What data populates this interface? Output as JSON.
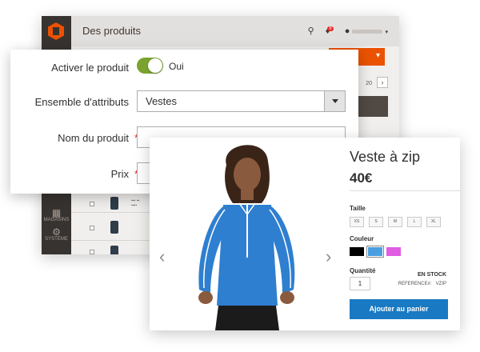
{
  "admin": {
    "title": "Des produits",
    "notification_count": "8",
    "pager_value": "20",
    "nav": [
      {
        "label": "MAGASINS",
        "icon": "store-icon"
      },
      {
        "label": "SYSTÈME",
        "icon": "gear-icon"
      }
    ]
  },
  "form": {
    "enable": {
      "label": "Activer le produit",
      "toggle_text": "Oui",
      "value": true
    },
    "attribute_set": {
      "label": "Ensemble d'attributs",
      "value": "Vestes"
    },
    "name": {
      "label": "Nom du produit",
      "required": "*",
      "value": ""
    },
    "price": {
      "label": "Prix",
      "required": "*",
      "value": ""
    }
  },
  "product": {
    "name": "Veste à zip",
    "price": "40€",
    "size_label": "Taille",
    "sizes": [
      "XS",
      "S",
      "M",
      "L",
      "XL"
    ],
    "color_label": "Couleur",
    "colors": [
      "#000000",
      "#4a9fe0",
      "#e05ce3"
    ],
    "selected_color": "#4a9fe0",
    "qty_label": "Quantité",
    "qty": "1",
    "stock": "EN STOCK",
    "sku_label": "REFERENCE#:",
    "sku": "VZIP",
    "cart_button": "Ajouter au panier",
    "accent_color": "#1979c3"
  }
}
